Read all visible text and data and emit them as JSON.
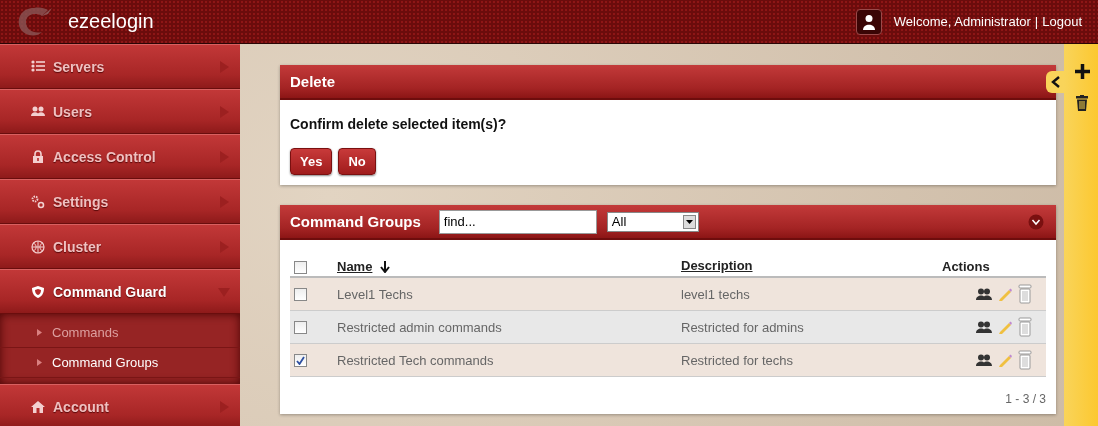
{
  "header": {
    "brand": "ezeelogin",
    "welcome": "Welcome, Administrator",
    "separator": "|",
    "logout": "Logout"
  },
  "sidebar": {
    "items": [
      {
        "label": "Servers",
        "expanded": false
      },
      {
        "label": "Users",
        "expanded": false
      },
      {
        "label": "Access Control",
        "expanded": false
      },
      {
        "label": "Settings",
        "expanded": false
      },
      {
        "label": "Cluster",
        "expanded": false
      },
      {
        "label": "Command Guard",
        "expanded": true,
        "children": [
          {
            "label": "Commands",
            "selected": false
          },
          {
            "label": "Command Groups",
            "selected": true
          }
        ]
      },
      {
        "label": "Account",
        "expanded": false
      }
    ]
  },
  "delete_panel": {
    "title": "Delete",
    "message": "Confirm delete selected item(s)?",
    "buttons": [
      "Yes",
      "No"
    ]
  },
  "groups_panel": {
    "title": "Command Groups",
    "search": {
      "value": "find..."
    },
    "filter": {
      "value": "All"
    },
    "table": {
      "select_all": {
        "checked": false
      },
      "columns": [
        {
          "label": "Name",
          "sorted_descending": true
        },
        {
          "label": "Description"
        },
        {
          "label": "Actions"
        }
      ],
      "rows": [
        {
          "checked": false,
          "name": "Level1 Techs",
          "description": "level1 techs"
        },
        {
          "checked": false,
          "name": "Restricted admin commands",
          "description": "Restricted for admins"
        },
        {
          "checked": true,
          "name": "Restricted Tech commands",
          "description": "Restricted for techs"
        }
      ]
    },
    "pagination": "1 - 3 / 3"
  }
}
